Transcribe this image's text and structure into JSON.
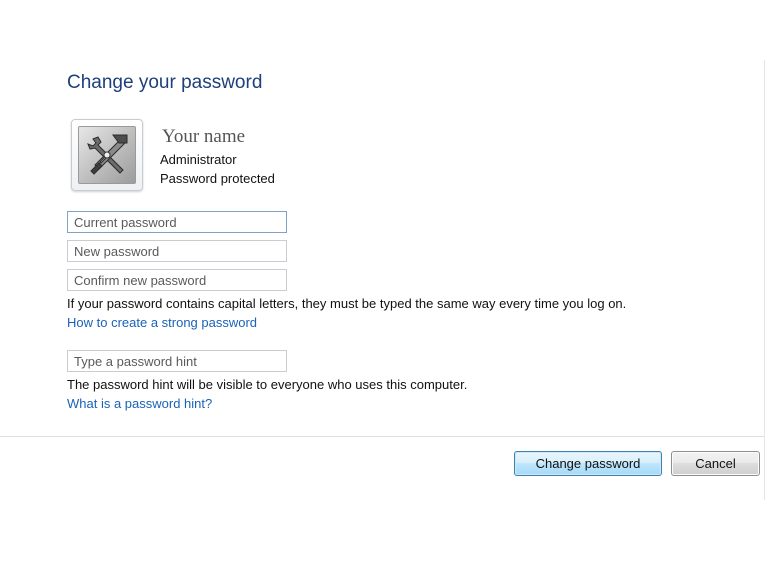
{
  "dialog": {
    "title": "Change your password"
  },
  "user": {
    "name": "Your name",
    "role": "Administrator",
    "status": "Password protected",
    "avatar_icon": "hammer-wrench-tools-icon"
  },
  "fields": {
    "current_password": {
      "value": "",
      "placeholder": "Current password"
    },
    "new_password": {
      "value": "",
      "placeholder": "New password"
    },
    "confirm_password": {
      "value": "",
      "placeholder": "Confirm new password"
    },
    "password_hint": {
      "value": "",
      "placeholder": "Type a password hint"
    }
  },
  "notes": {
    "capitals": "If your password contains capital letters, they must be typed the same way every time you log on.",
    "hint_visibility": "The password hint will be visible to everyone who uses this computer."
  },
  "links": {
    "strong_password": "How to create a strong password",
    "what_is_hint": "What is a password hint?"
  },
  "buttons": {
    "change": "Change password",
    "cancel": "Cancel"
  },
  "colors": {
    "title": "#1e3f7a",
    "link": "#1a62b8",
    "primary_button_border": "#3c7fb1"
  }
}
